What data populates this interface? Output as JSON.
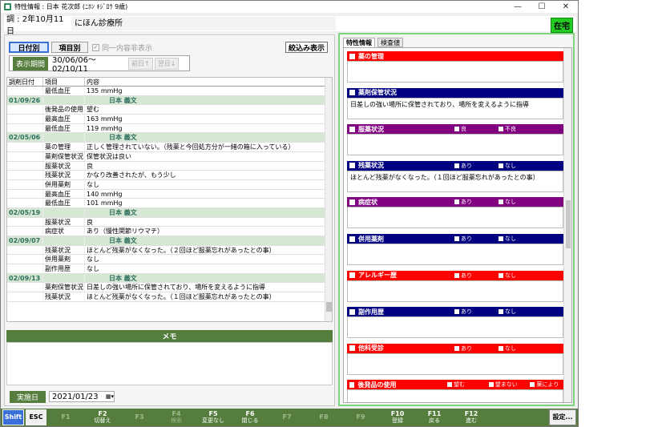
{
  "window": {
    "title": "特性情報 : 日本 花次郎 (ﾆﾎﾝ ｷｼﾞﾛｳ 9歳)"
  },
  "patient": {
    "date": "調 : 2年10月11日",
    "clinic": "にほん診療所",
    "status_badge": "在宅"
  },
  "left": {
    "tab_date": "日付別",
    "tab_item": "項目別",
    "dup_hide": "同一内容非表示",
    "filter_btn": "絞込み表示",
    "period_label": "表示期間",
    "period_value": "30/06/06～02/10/11",
    "prev_btn": "前日↑",
    "next_btn": "翌日↓",
    "columns": [
      "調剤日付",
      "項目",
      "内容"
    ],
    "rows": [
      {
        "d": "",
        "i": "最低血圧",
        "c": "135 mmHg",
        "g": false
      },
      {
        "d": "01/09/26",
        "i": "",
        "c": "日本 義文",
        "g": true
      },
      {
        "d": "",
        "i": "後発品の使用",
        "c": "望む",
        "g": false
      },
      {
        "d": "",
        "i": "最高血圧",
        "c": "163 mmHg",
        "g": false
      },
      {
        "d": "",
        "i": "最低血圧",
        "c": "119 mmHg",
        "g": false
      },
      {
        "d": "02/05/06",
        "i": "",
        "c": "日本 義文",
        "g": true
      },
      {
        "d": "",
        "i": "薬の管理",
        "c": "正しく管理されていない。（残薬と今回処方分が一緒の箱に入っている）",
        "g": false
      },
      {
        "d": "",
        "i": "薬剤保管状況",
        "c": "保管状況は良い",
        "g": false
      },
      {
        "d": "",
        "i": "服薬状況",
        "c": "良",
        "g": false
      },
      {
        "d": "",
        "i": "残薬状況",
        "c": "かなり改善されたが、もう少し",
        "g": false
      },
      {
        "d": "",
        "i": "併用薬剤",
        "c": "なし",
        "g": false
      },
      {
        "d": "",
        "i": "最高血圧",
        "c": "140 mmHg",
        "g": false
      },
      {
        "d": "",
        "i": "最低血圧",
        "c": "101 mmHg",
        "g": false
      },
      {
        "d": "02/05/19",
        "i": "",
        "c": "日本 義文",
        "g": true
      },
      {
        "d": "",
        "i": "服薬状況",
        "c": "良",
        "g": false
      },
      {
        "d": "",
        "i": "病症状",
        "c": "あり（慢性関節リウマチ）",
        "g": false
      },
      {
        "d": "02/09/07",
        "i": "",
        "c": "日本 義文",
        "g": true
      },
      {
        "d": "",
        "i": "残薬状況",
        "c": "ほとんど残薬がなくなった。（２回ほど服薬忘れがあったとの事）",
        "g": false
      },
      {
        "d": "",
        "i": "併用薬剤",
        "c": "なし",
        "g": false
      },
      {
        "d": "",
        "i": "副作用歴",
        "c": "なし",
        "g": false
      },
      {
        "d": "02/09/13",
        "i": "",
        "c": "日本 義文",
        "g": true
      },
      {
        "d": "",
        "i": "薬剤保管状況",
        "c": "日差しの強い場所に保管されており、場所を変えるように指導",
        "g": false
      },
      {
        "d": "",
        "i": "残薬状況",
        "c": "ほとんど残薬がなくなった。（１回ほど服薬忘れがあったとの事）",
        "g": false
      }
    ],
    "memo_label": "メモ",
    "date_label": "実施日",
    "date_value": "2021/01/23"
  },
  "right": {
    "tab_props": "特性情報",
    "tab_tests": "検査値",
    "sections": [
      {
        "title": "薬の管理",
        "color": "#ff0000",
        "opts": [],
        "text": ""
      },
      {
        "title": "薬剤保管状況",
        "color": "#000080",
        "opts": [],
        "text": "日差しの強い場所に保管されており、場所を変えるように指導"
      },
      {
        "title": "服薬状況",
        "color": "#800080",
        "opts": [
          "良",
          "不良"
        ],
        "text": ""
      },
      {
        "title": "残薬状況",
        "color": "#000080",
        "opts": [
          "あり",
          "なし"
        ],
        "text": "ほとんど残薬がなくなった。（１回ほど服薬忘れがあったとの事）"
      },
      {
        "title": "病症状",
        "color": "#800080",
        "opts": [
          "あり",
          "なし"
        ],
        "text": ""
      },
      {
        "title": "併用薬剤",
        "color": "#000080",
        "opts": [
          "あり",
          "なし"
        ],
        "text": ""
      },
      {
        "title": "アレルギー歴",
        "color": "#ff0000",
        "opts": [
          "あり",
          "なし"
        ],
        "text": ""
      },
      {
        "title": "副作用歴",
        "color": "#000080",
        "opts": [
          "あり",
          "なし"
        ],
        "text": ""
      },
      {
        "title": "他科受診",
        "color": "#ff0000",
        "opts": [
          "あり",
          "なし"
        ],
        "text": ""
      },
      {
        "title": "後発品の使用",
        "color": "#ff0000",
        "opts": [
          "望む",
          "望まない",
          "薬により"
        ],
        "text": ""
      }
    ]
  },
  "fkeys": [
    {
      "k": "Shift",
      "l": "",
      "t": "shift"
    },
    {
      "k": "ESC",
      "l": "",
      "t": "esc"
    },
    {
      "k": "F1",
      "l": "",
      "t": "dis"
    },
    {
      "k": "F2",
      "l": "切替え",
      "t": "on"
    },
    {
      "k": "F3",
      "l": "",
      "t": "dis"
    },
    {
      "k": "F4",
      "l": "検索",
      "t": "dis"
    },
    {
      "k": "F5",
      "l": "変更なし",
      "t": "on"
    },
    {
      "k": "F6",
      "l": "閉じる",
      "t": "on"
    },
    {
      "k": "F7",
      "l": "",
      "t": "dis"
    },
    {
      "k": "F8",
      "l": "",
      "t": "dis"
    },
    {
      "k": "F9",
      "l": "",
      "t": "dis"
    },
    {
      "k": "F10",
      "l": "登録",
      "t": "on"
    },
    {
      "k": "F11",
      "l": "戻る",
      "t": "on"
    },
    {
      "k": "F12",
      "l": "進む",
      "t": "on"
    },
    {
      "k": "設定...",
      "l": "",
      "t": "set"
    }
  ]
}
